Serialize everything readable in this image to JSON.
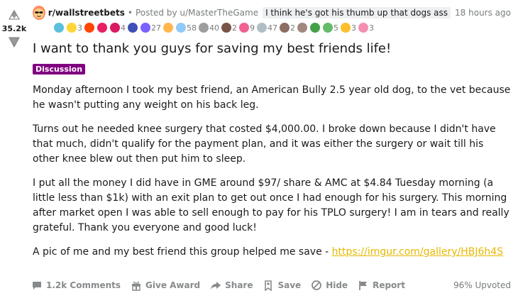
{
  "vote": {
    "score": "35.2k"
  },
  "meta": {
    "subreddit": "r/wallstreetbets",
    "dot": "•",
    "posted_by": "Posted by u/MasterTheGame",
    "user_flair": "I think he's got his thumb up that dogs ass",
    "time": "18 hours ago"
  },
  "awards": [
    {
      "icon": "laughing-award-icon",
      "color": "#5bc0de",
      "count": ""
    },
    {
      "icon": "gold-award-icon",
      "color": "#ffd635",
      "count": "3"
    },
    {
      "icon": "heart-eyes-award-icon",
      "color": "#ff4500",
      "count": ""
    },
    {
      "icon": "wholesome-award-icon",
      "color": "#e91e63",
      "count": ""
    },
    {
      "icon": "gift-award-icon",
      "color": "#d81b60",
      "count": "4"
    },
    {
      "icon": "take-my-energy-award-icon",
      "color": "#3f51b5",
      "count": ""
    },
    {
      "icon": "rocket-award-icon",
      "color": "#7b61ff",
      "count": "27"
    },
    {
      "icon": "hugz-award-icon",
      "color": "#ffb74d",
      "count": ""
    },
    {
      "icon": "helpful-award-icon",
      "color": "#90caf9",
      "count": "58"
    },
    {
      "icon": "stonks-award-icon",
      "color": "#9e9e9e",
      "count": "40"
    },
    {
      "icon": "diamond-hands-award-icon",
      "color": "#795548",
      "count": "2"
    },
    {
      "icon": "heartwarming-award-icon",
      "color": "#f06292",
      "count": "9"
    },
    {
      "icon": "bravo-award-icon",
      "color": "#b0bec5",
      "count": "47"
    },
    {
      "icon": "this-award-icon",
      "color": "#8d6e63",
      "count": "2"
    },
    {
      "icon": "doge-award-icon",
      "color": "#a1887f",
      "count": ""
    },
    {
      "icon": "tree-hug-award-icon",
      "color": "#43a047",
      "count": ""
    },
    {
      "icon": "wholesome-seal-award-icon",
      "color": "#66bb6a",
      "count": "5"
    },
    {
      "icon": "sun-award-icon",
      "color": "#fbc02d",
      "count": "3"
    },
    {
      "icon": "puppy-award-icon",
      "color": "#f48fb1",
      "count": "3"
    }
  ],
  "post": {
    "title": "I want to thank you guys for saving my best friends life!",
    "flair": "Discussion",
    "paragraphs": [
      "Monday afternoon I took my best friend, an American Bully 2.5 year old dog, to the vet because he wasn't putting any weight on his back leg.",
      "Turns out he needed knee surgery that costed $4,000.00. I broke down because I didn't have that much, didn't qualify for the payment plan, and it was either the surgery or wait till his other knee blew out then put him to sleep.",
      "I put all the money I did have in GME around $97/ share & AMC at $4.84 Tuesday morning (a little less than $1k) with an exit plan to get out once I had enough for his surgery. This morning after market open I was able to sell enough to pay for his TPLO surgery! I am in tears and really grateful. Thank you everyone and good luck!"
    ],
    "last_paragraph_text": "A pic of me and my best friend this group helped me save - ",
    "link_text": "https://imgur.com/gallery/HBJ6h4S"
  },
  "actions": {
    "comments": "1.2k Comments",
    "give_award": "Give Award",
    "share": "Share",
    "save": "Save",
    "hide": "Hide",
    "report": "Report",
    "upvoted": "96% Upvoted"
  },
  "colors": {
    "flair_bg": "#800080",
    "link": "#e6b800",
    "meta_text": "#787c7e"
  }
}
